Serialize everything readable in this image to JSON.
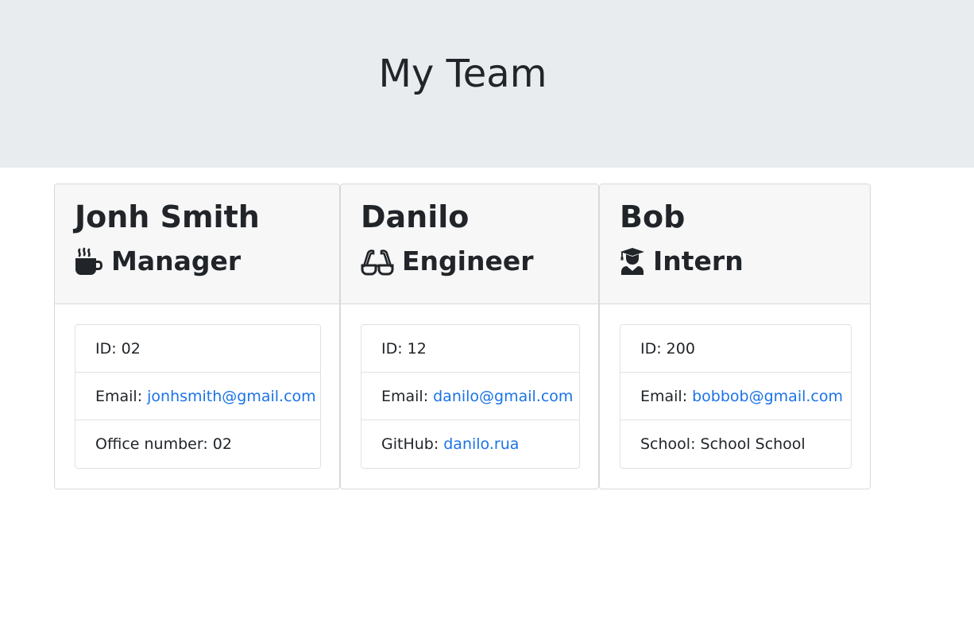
{
  "header": {
    "title": "My Team"
  },
  "team": [
    {
      "name": "Jonh Smith",
      "role": "Manager",
      "icon": "coffee-mug-icon",
      "id_label": "ID: 02",
      "email_prefix": "Email:",
      "email": "jonhsmith@gmail.com",
      "extra_label": "Office number: 02"
    },
    {
      "name": "Danilo",
      "role": "Engineer",
      "icon": "glasses-icon",
      "id_label": "ID: 12",
      "email_prefix": "Email:",
      "email": "danilo@gmail.com",
      "extra_prefix": "GitHub:",
      "extra_link": "danilo.rua"
    },
    {
      "name": "Bob",
      "role": "Intern",
      "icon": "graduate-icon",
      "id_label": "ID: 200",
      "email_prefix": "Email:",
      "email": "bobbob@gmail.com",
      "extra_label": "School: School School"
    }
  ],
  "colors": {
    "jumbotron": "#e9ecef",
    "card_header": "#f7f7f7",
    "link": "#1a73e8",
    "text": "#212529"
  }
}
